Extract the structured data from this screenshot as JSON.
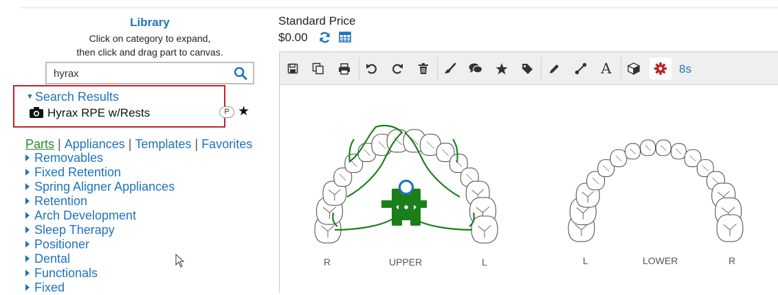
{
  "library": {
    "title": "Library",
    "help_line1": "Click on category to expand,",
    "help_line2": "then click and drag part to canvas.",
    "search": {
      "value": "hyrax",
      "icon": "search-icon"
    },
    "results": {
      "heading": "Search Results",
      "items": [
        {
          "label": "Hyrax RPE w/Rests",
          "icon": "camera-icon",
          "badge": "P",
          "favorite": true
        }
      ]
    },
    "tabs": [
      {
        "label": "Parts",
        "active": true
      },
      {
        "label": "Appliances",
        "active": false
      },
      {
        "label": "Templates",
        "active": false
      },
      {
        "label": "Favorites",
        "active": false
      }
    ],
    "tab_separator": "|",
    "categories": [
      "Removables",
      "Fixed Retention",
      "Spring Aligner Appliances",
      "Retention",
      "Arch Development",
      "Sleep Therapy",
      "Positioner",
      "Dental",
      "Functionals",
      "Fixed"
    ]
  },
  "pricing": {
    "label": "Standard Price",
    "value": "$0.00"
  },
  "toolbar": {
    "buttons": [
      "save-icon",
      "copy-icon",
      "print-icon",
      "undo-icon",
      "redo-icon",
      "trash-icon",
      "brush-icon",
      "comments-icon",
      "star-icon",
      "tag-icon",
      "pencil-icon",
      "connector-icon",
      "text-icon",
      "cube-icon",
      "gear-icon"
    ],
    "text_tool": "A",
    "timer": "8s"
  },
  "canvas": {
    "upper": {
      "label": "UPPER",
      "left": "R",
      "right": "L"
    },
    "lower": {
      "label": "LOWER",
      "left": "L",
      "right": "R"
    }
  },
  "colors": {
    "link": "#1e73be",
    "active_tab": "#2a8a2a",
    "highlight_border": "#c0202a",
    "appliance": "#1a7f1a",
    "screw_ring": "#1e73be",
    "gear": "#c0202a"
  }
}
